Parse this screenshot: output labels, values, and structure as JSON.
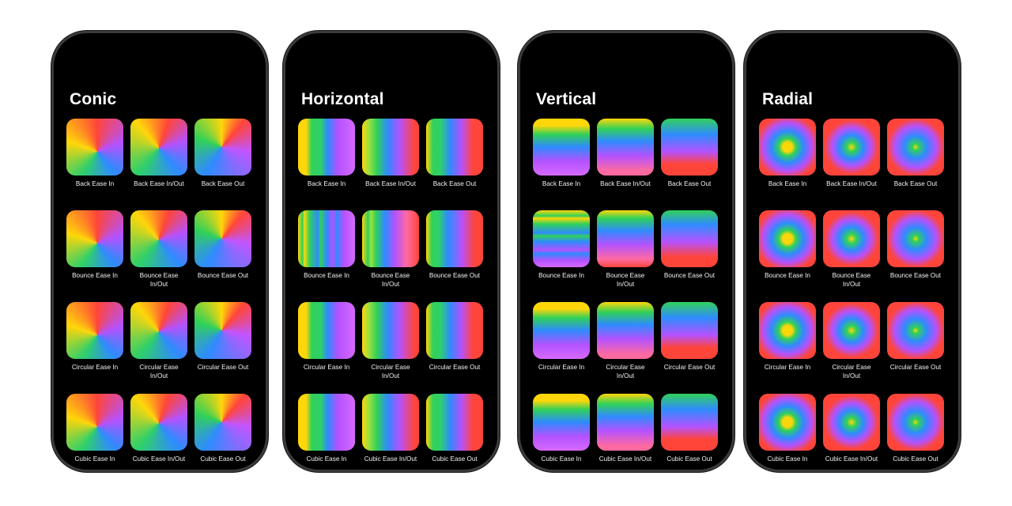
{
  "phones": [
    {
      "title": "Conic",
      "cells": [
        "Back Ease In",
        "Back Ease In/Out",
        "Back Ease Out",
        "Bounce Ease In",
        "Bounce Ease In/Out",
        "Bounce Ease Out",
        "Circular Ease In",
        "Circular Ease In/Out",
        "Circular Ease Out",
        "Cubic Ease In",
        "Cubic Ease In/Out",
        "Cubic Ease Out"
      ]
    },
    {
      "title": "Horizontal",
      "cells": [
        "Back Ease In",
        "Back Ease In/Out",
        "Back Ease Out",
        "Bounce Ease In",
        "Bounce Ease In/Out",
        "Bounce Ease Out",
        "Circular Ease In",
        "Circular Ease In/Out",
        "Circular Ease Out",
        "Cubic Ease In",
        "Cubic Ease In/Out",
        "Cubic Ease Out"
      ]
    },
    {
      "title": "Vertical",
      "cells": [
        "Back Ease In",
        "Back Ease In/Out",
        "Back Ease Out",
        "Bounce Ease In",
        "Bounce Ease In/Out",
        "Bounce Ease Out",
        "Circular Ease In",
        "Circular Ease In/Out",
        "Circular Ease Out",
        "Cubic Ease In",
        "Cubic Ease In/Out",
        "Cubic Ease Out"
      ]
    },
    {
      "title": "Radial",
      "cells": [
        "Back Ease In",
        "Back Ease In/Out",
        "Back Ease Out",
        "Bounce Ease In",
        "Bounce Ease In/Out",
        "Bounce Ease Out",
        "Circular Ease In",
        "Circular Ease In/Out",
        "Circular Ease Out",
        "Cubic Ease In",
        "Cubic Ease In/Out",
        "Cubic Ease Out"
      ]
    }
  ],
  "colors": {
    "red": "#ff453a",
    "purple": "#b452ff",
    "blue": "#2f8bff",
    "green": "#30d158",
    "yellow": "#ffd60a"
  }
}
